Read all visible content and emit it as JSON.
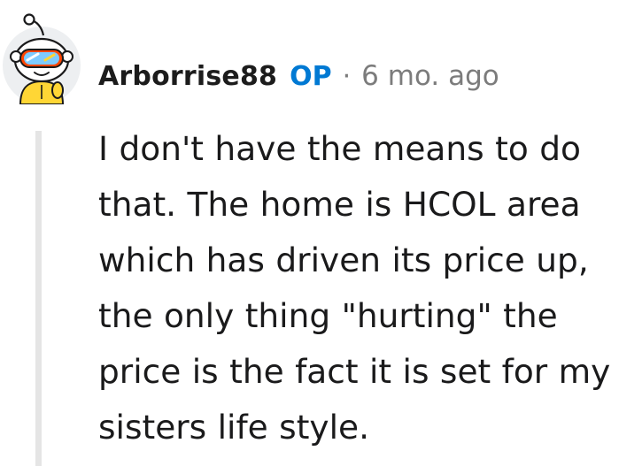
{
  "comment": {
    "author": "Arborrise88",
    "op_badge": "OP",
    "separator": "·",
    "timestamp": "6 mo. ago",
    "body": "I don't have the means to do that. The home is HCOL area which has driven its price up, the only thing \"hurting\" the price is the fact it is set for my sisters life style.",
    "avatar_icon": "snoo-avatar-icon"
  },
  "colors": {
    "op_accent": "#0079d3",
    "meta_gray": "#7c7c7c",
    "thread_line": "#e5e5e5",
    "avatar_shirt": "#ffd635",
    "avatar_goggles": "#ff4500"
  }
}
